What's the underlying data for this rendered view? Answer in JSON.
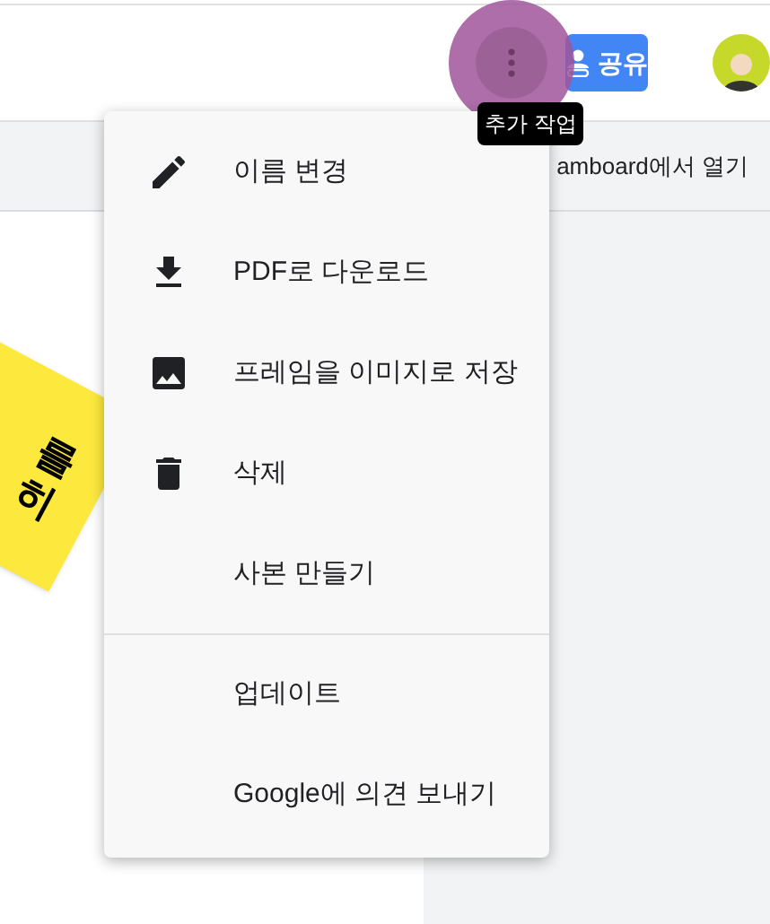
{
  "toolbar": {
    "more_button": {
      "pressed": true,
      "tooltip": "추가 작업"
    },
    "share_button": {
      "label": "공유"
    }
  },
  "secondary_bar": {
    "open_link": "amboard에서 열기"
  },
  "sticky_note": {
    "lines": [
      "를",
      "히"
    ]
  },
  "menu": {
    "groups": [
      [
        {
          "kind": "rename",
          "label": "이름 변경"
        },
        {
          "kind": "download",
          "label": "PDF로 다운로드"
        },
        {
          "kind": "image",
          "label": "프레임을 이미지로 저장"
        },
        {
          "kind": "delete",
          "label": "삭제"
        },
        {
          "kind": "plain",
          "label": "사본 만들기"
        }
      ],
      [
        {
          "kind": "plain",
          "label": "업데이트"
        },
        {
          "kind": "plain",
          "label": "Google에 의견 보내기"
        }
      ]
    ]
  }
}
